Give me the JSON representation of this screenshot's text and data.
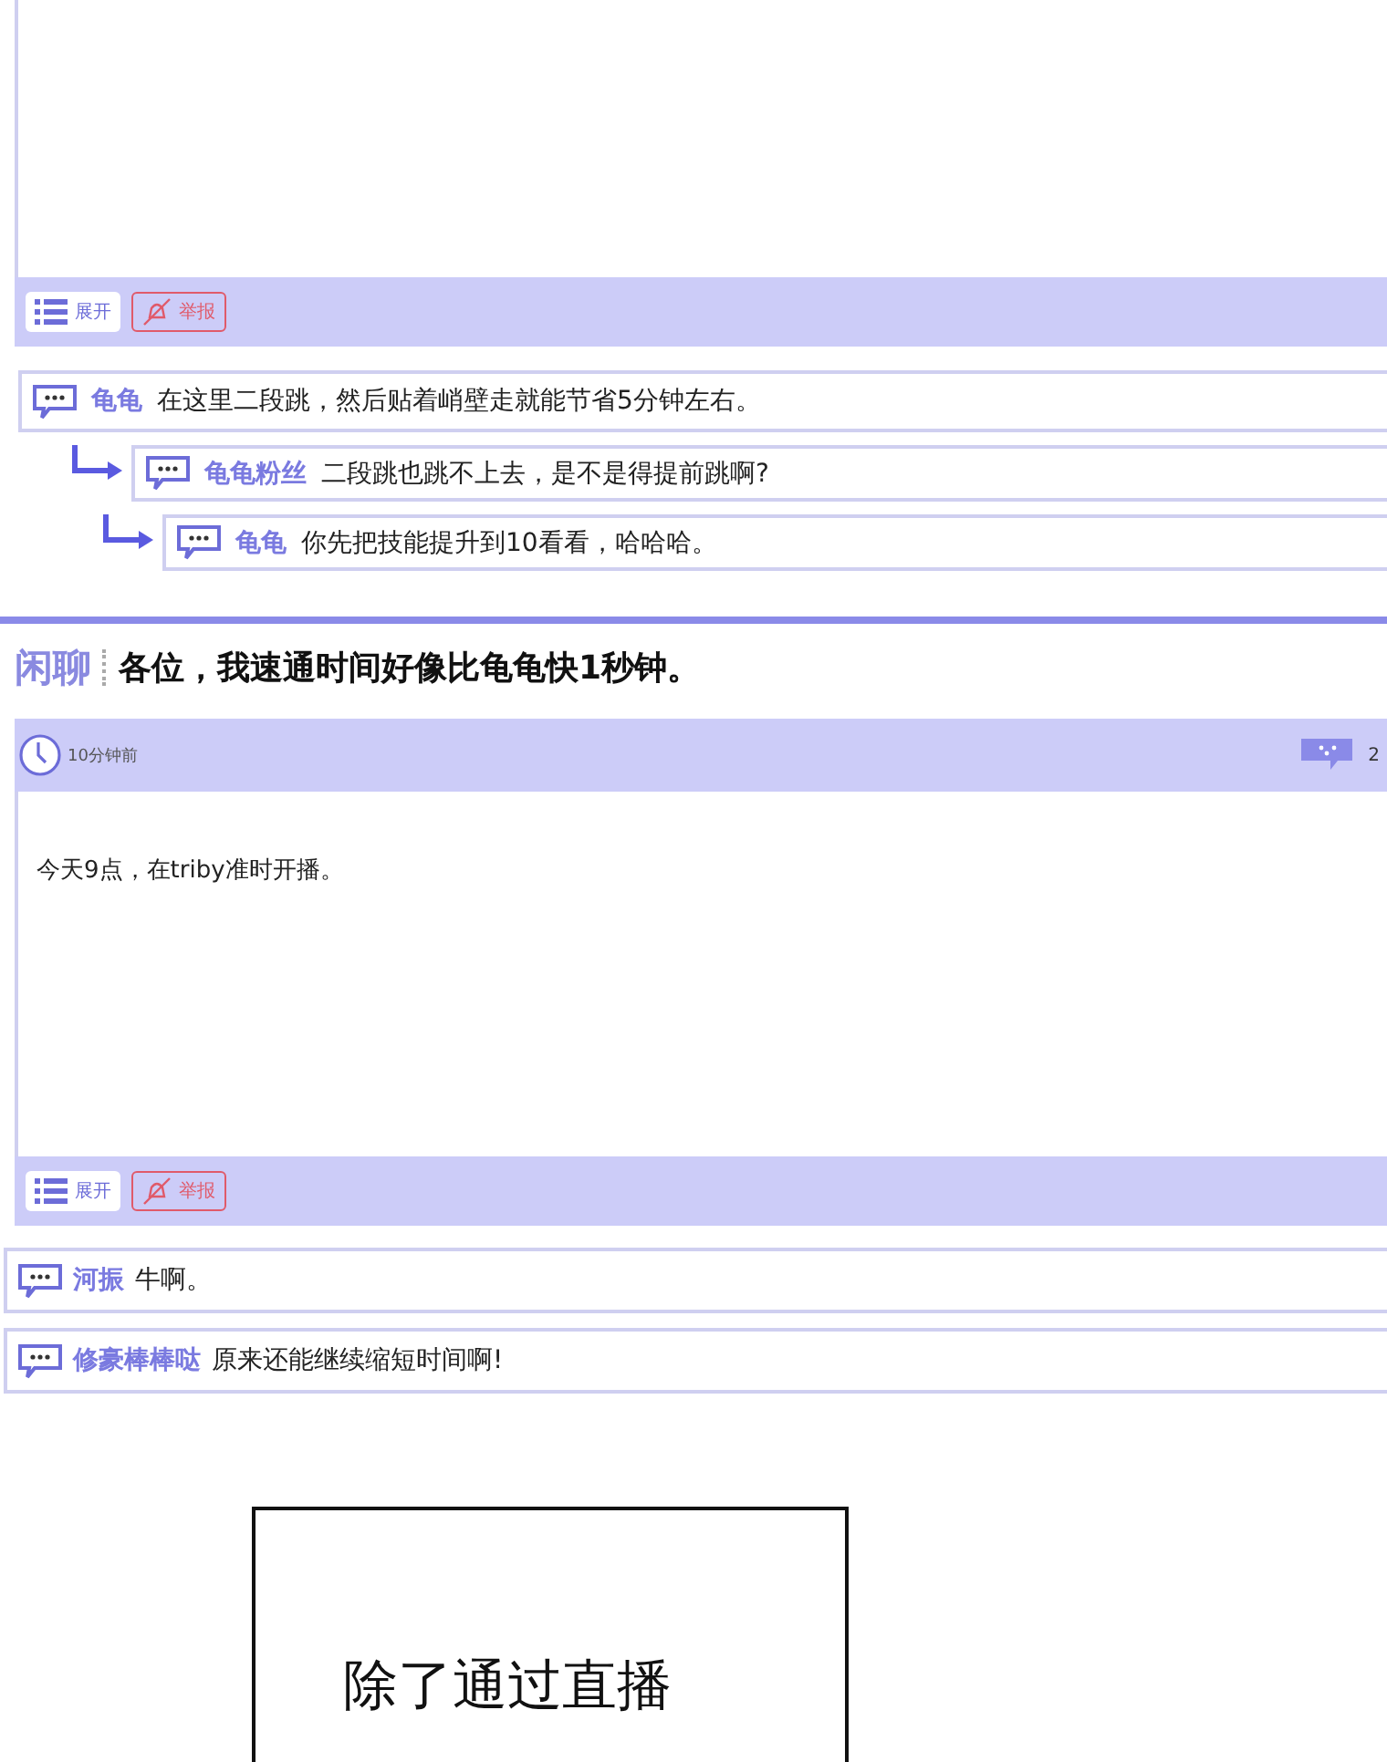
{
  "previous_post": {
    "toolbar": {
      "expand": "展开",
      "report": "举报"
    },
    "comments": [
      {
        "author": "龟龟",
        "text": "在这里二段跳，然后贴着峭壁走就能节省5分钟左右。",
        "children": [
          {
            "author": "龟龟粉丝",
            "text": "二段跳也跳不上去，是不是得提前跳啊?",
            "children": [
              {
                "author": "龟龟",
                "text": "你先把技能提升到10看看，哈哈哈。"
              }
            ]
          }
        ]
      }
    ]
  },
  "post": {
    "category": "闲聊",
    "title": "各位，我速通时间好像比龟龟快1秒钟。",
    "time": "10分钟前",
    "comment_count": "2",
    "body": "今天9点，在triby准时开播。",
    "toolbar": {
      "expand": "展开",
      "report": "举报"
    },
    "comments": [
      {
        "author": "河振",
        "text": "牛啊。"
      },
      {
        "author": "修豪棒棒哒",
        "text": "原来还能继续缩短时间啊!"
      }
    ]
  },
  "caption": {
    "text": "除了通过直播"
  }
}
